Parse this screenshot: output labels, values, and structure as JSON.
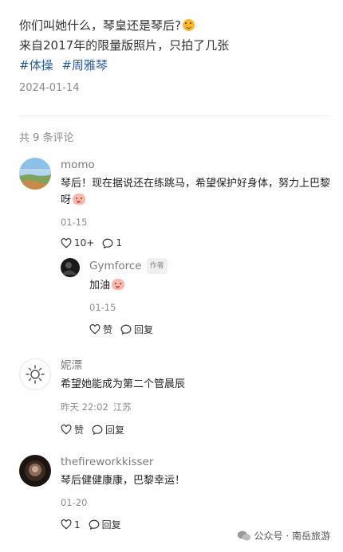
{
  "post": {
    "line1": "你们叫她什么，琴皇还是琴后?",
    "line1_emoji": "smile-emoji",
    "line2": "来自2017年的限量版照片，只拍了几张",
    "tags": [
      "#体操",
      "#周雅琴"
    ],
    "date": "2024-01-14"
  },
  "comments_header": "共 9 条评论",
  "comments": [
    {
      "name": "momo",
      "text": "琴后！现在据说还在练跳马，希望保护好身体，努力上巴黎呀",
      "date": "01-15",
      "likes": "10+",
      "replies": "1",
      "reply": {
        "name": "Gymforce",
        "badge": "作者",
        "text": "加油",
        "date": "01-15",
        "like_label": "赞",
        "reply_label": "回复"
      }
    },
    {
      "name": "妮漂",
      "text": "希望她能成为第二个管晨辰",
      "date": "昨天 22:02",
      "location": "江苏",
      "like_label": "赞",
      "reply_label": "回复"
    },
    {
      "name": "thefireworkkisser",
      "text": "琴后健健康康，巴黎幸运！",
      "date": "01-20",
      "likes": "1",
      "reply_label": "回复"
    }
  ],
  "watermark": "公众号 · 南岳旅游"
}
